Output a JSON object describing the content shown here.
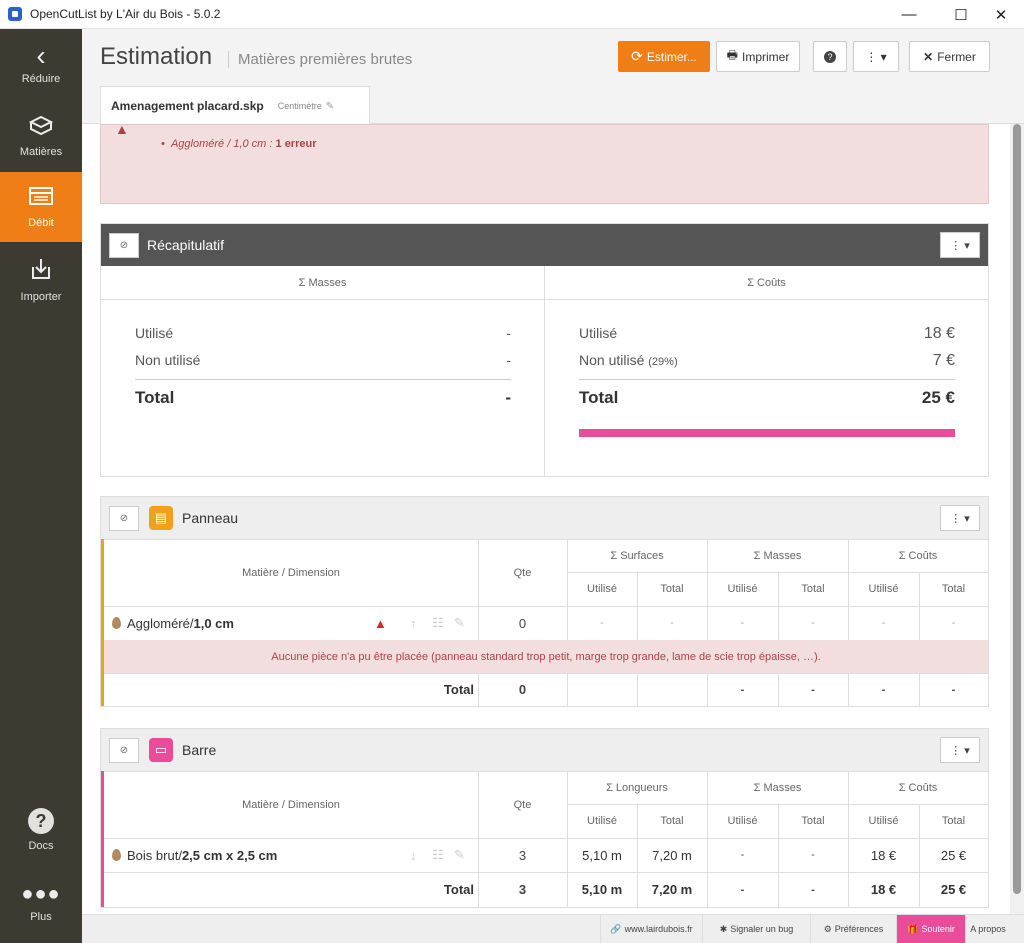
{
  "window": {
    "title": "OpenCutList by L'Air du Bois - 5.0.2",
    "minimize": "—",
    "maximize": "☐",
    "close": "✕"
  },
  "sidebar": {
    "items": [
      {
        "label": "Réduire",
        "icon": "chevron-left-icon"
      },
      {
        "label": "Matières",
        "icon": "materials-icon"
      },
      {
        "label": "Débit",
        "icon": "cutlist-icon"
      },
      {
        "label": "Importer",
        "icon": "import-icon"
      },
      {
        "label": "Docs",
        "icon": "question-icon"
      },
      {
        "label": "Plus",
        "icon": "more-icon"
      }
    ],
    "active_color": "#f07e16"
  },
  "header": {
    "title": "Estimation",
    "subtitle": "Matières premières brutes",
    "buttons": {
      "estimate": "Estimer...",
      "print": "Imprimer",
      "close": "Fermer"
    },
    "tab": {
      "filename": "Amenagement placard.skp",
      "unit": "Centimètre"
    }
  },
  "error_box": {
    "material": "Aggloméré / 1,0 cm",
    "separator": " : ",
    "error": "1 erreur"
  },
  "summary": {
    "title": "Récapitulatif",
    "masses_header": "Σ Masses",
    "costs_header": "Σ Coûts",
    "masses": {
      "used_label": "Utilisé",
      "used": "-",
      "unused_label": "Non utilisé",
      "unused": "-",
      "total_label": "Total",
      "total": "-"
    },
    "costs": {
      "used_label": "Utilisé",
      "used": "18 €",
      "unused_label": "Non utilisé",
      "unused_pct": "(29%)",
      "unused": "7 €",
      "total_label": "Total",
      "total": "25 €"
    },
    "cost_bar_used_fraction": 0.71
  },
  "panneau": {
    "title": "Panneau",
    "color": "#f0a11a",
    "headers": {
      "mat": "Matière / Dimension",
      "qte": "Qte",
      "surfaces": "Σ Surfaces",
      "masses": "Σ Masses",
      "costs": "Σ Coûts",
      "used": "Utilisé",
      "total": "Total"
    },
    "row": {
      "name": "Aggloméré",
      "sep": " / ",
      "dim": "1,0 cm",
      "qte": "0",
      "values": [
        "-",
        "-",
        "-",
        "-",
        "-",
        "-"
      ]
    },
    "error_msg": "Aucune pièce n'a pu être placée (panneau standard trop petit, marge trop grande, lame de scie trop épaisse, …).",
    "total": {
      "label": "Total",
      "qte": "0",
      "values": [
        "",
        "",
        "-",
        "-",
        "-",
        "-"
      ]
    }
  },
  "barre": {
    "title": "Barre",
    "color": "#e94c98",
    "headers": {
      "mat": "Matière / Dimension",
      "qte": "Qte",
      "lengths": "Σ Longueurs",
      "masses": "Σ Masses",
      "costs": "Σ Coûts",
      "used": "Utilisé",
      "total": "Total"
    },
    "row": {
      "name": "Bois brut",
      "sep": " / ",
      "dim": "2,5 cm x 2,5 cm",
      "qte": "3",
      "values": [
        "5,10 m",
        "7,20 m",
        "-",
        "-",
        "18 €",
        "25 €"
      ]
    },
    "total": {
      "label": "Total",
      "qte": "3",
      "values": [
        "5,10 m",
        "7,20 m",
        "-",
        "-",
        "18 €",
        "25 €"
      ]
    }
  },
  "footer": {
    "site": "www.lairdubois.fr",
    "bug": "Signaler un bug",
    "prefs": "Préférences",
    "support": "Soutenir",
    "about": "A propos"
  }
}
